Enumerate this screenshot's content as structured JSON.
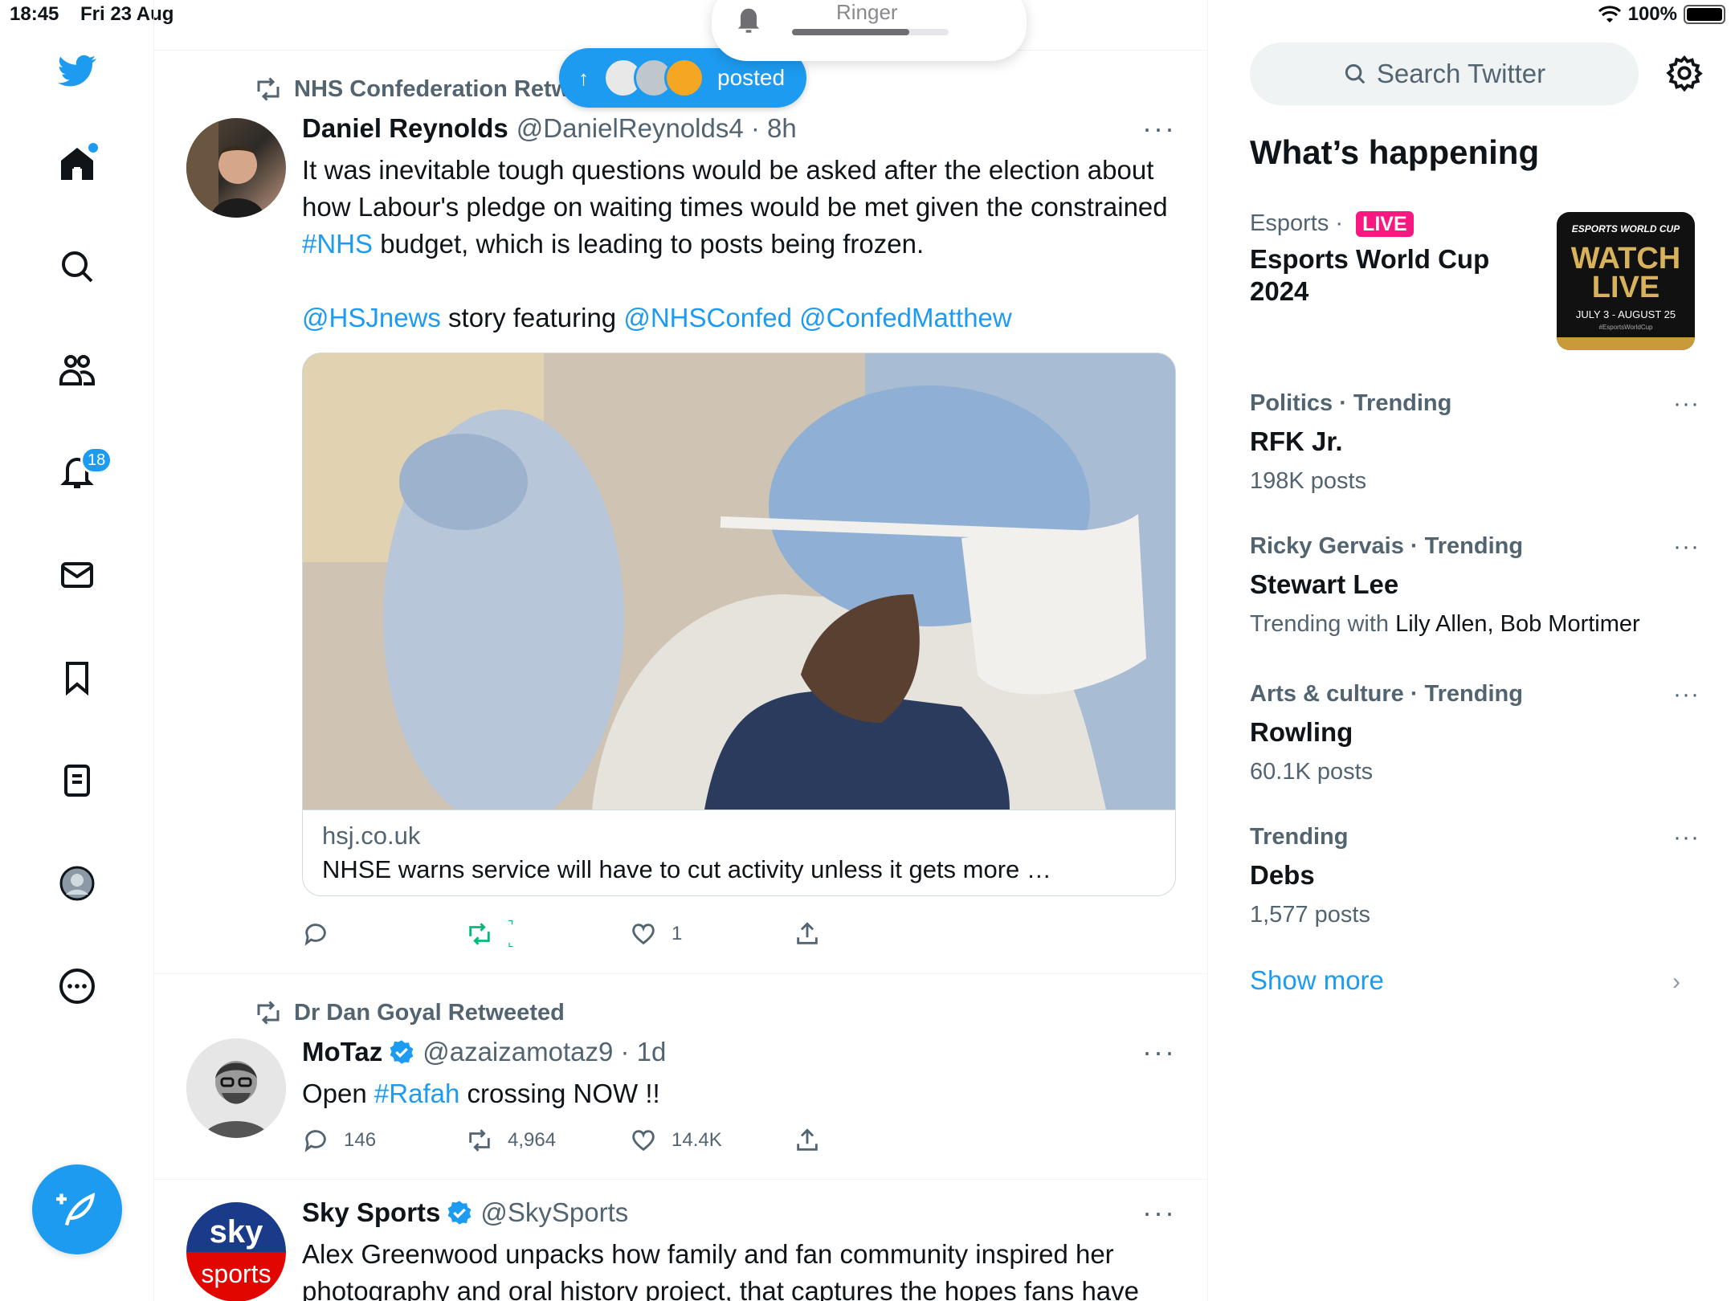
{
  "status_bar": {
    "time": "18:45",
    "date": "Fri 23 Aug",
    "battery": "100%"
  },
  "ringer": {
    "label": "Ringer",
    "level": 0.75
  },
  "posted_pill": {
    "label": "posted"
  },
  "sidebar": {
    "notifications_count": "18",
    "items": [
      "home-icon",
      "explore-icon",
      "communities-icon",
      "notifications-icon",
      "messages-icon",
      "bookmarks-icon",
      "lists-icon",
      "profile-icon",
      "more-icon"
    ]
  },
  "tweets": [
    {
      "retweeted_by": "NHS Confederation Retweeted",
      "name": "Daniel Reynolds",
      "meta": "@DanielReynolds4 · 8h",
      "text_1": "It was inevitable tough questions would be asked after the election about how Labour's pledge on waiting times would be met given the constrained ",
      "hashtag": "#NHS",
      "text_2": " budget, which is leading to posts being frozen.",
      "mention_1": "@HSJnews",
      "text_3": " story featuring ",
      "mention_2": "@NHSConfed",
      "mention_3": "@ConfedMatthew",
      "card_domain": "hsj.co.uk",
      "card_title": "NHSE warns service will have to cut activity unless it gets more …",
      "likes": "1"
    },
    {
      "retweeted_by": "Dr Dan Goyal Retweeted",
      "name": "MoTaz",
      "meta": "@azaizamotaz9 · 1d",
      "text_1": "Open ",
      "hashtag": "#Rafah",
      "text_2": " crossing NOW !!",
      "replies": "146",
      "retweets": "4,964",
      "likes": "14.4K"
    },
    {
      "name": "Sky Sports",
      "meta": "@SkySports",
      "text": "Alex Greenwood unpacks how family and fan community inspired her photography and oral history project, that captures the hopes fans have"
    }
  ],
  "right": {
    "search_placeholder": "Search Twitter",
    "section_title": "What’s happening",
    "trends": [
      {
        "category": "Esports · ",
        "badge": "LIVE",
        "name": "Esports World Cup 2024"
      },
      {
        "category": "Politics · Trending",
        "name": "RFK Jr.",
        "sub": "198K posts"
      },
      {
        "category": "Ricky Gervais · Trending",
        "name": "Stewart Lee",
        "sub_prefix": "Trending with ",
        "sub_names": "Lily Allen, Bob Mortimer"
      },
      {
        "category": "Arts & culture · Trending",
        "name": "Rowling",
        "sub": "60.1K posts"
      },
      {
        "category": "Trending",
        "name": "Debs",
        "sub": "1,577 posts"
      }
    ],
    "esports_image": {
      "line1": "ESPORTS WORLD CUP",
      "line2": "WATCH",
      "line3": "LIVE",
      "line4": "JULY 3 - AUGUST 25",
      "line5": "#EsportsWorldCup"
    },
    "show_more": "Show more"
  },
  "colors": {
    "accent": "#1d9bf0",
    "live": "#f91880",
    "retweet_active": "#00ba7c"
  }
}
